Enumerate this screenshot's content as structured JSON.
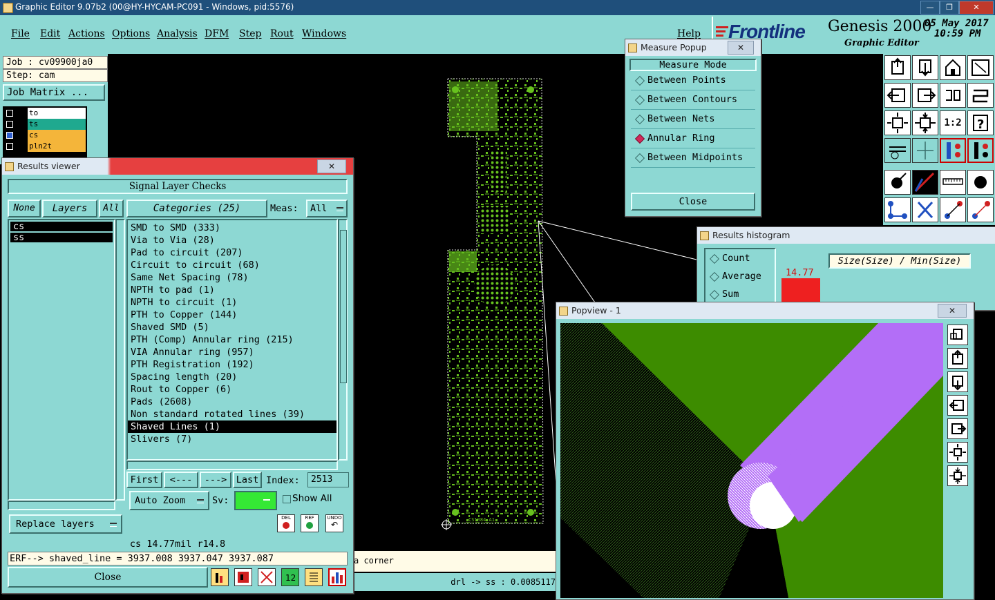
{
  "window": {
    "title": "Graphic Editor 9.07b2 (00@HY-HYCAM-PC091 - Windows, pid:5576)",
    "controls": [
      "minimize",
      "maximize",
      "close"
    ]
  },
  "menu": {
    "items": [
      "File",
      "Edit",
      "Actions",
      "Options",
      "Analysis",
      "DFM",
      "Step",
      "Rout",
      "Windows"
    ],
    "help": "Help"
  },
  "brand": {
    "logo": "Frontline",
    "product": "Genesis 2000",
    "subtitle": "Graphic Editor",
    "date": "05 May 2017",
    "time": "10:59 PM"
  },
  "job": {
    "job_label": "Job : cv09900ja0",
    "step_label": "Step: cam",
    "matrix_button": "Job Matrix ..."
  },
  "layers": [
    {
      "name": "to",
      "color": "#ffffff"
    },
    {
      "name": "ts",
      "color": "#1fa98f"
    },
    {
      "name": "cs",
      "color": "#f4b53a"
    },
    {
      "name": "pln2t",
      "color": "#f4b53a"
    }
  ],
  "results_viewer": {
    "title": "Results viewer",
    "header": "Signal Layer Checks",
    "none_btn": "None",
    "layers_btn": "Layers",
    "all_btn": "All",
    "layer_list": [
      "cs",
      "ss"
    ],
    "categories_btn": "Categories (25)",
    "meas_label": "Meas:",
    "meas_value": "All",
    "categories": [
      "SMD to SMD (333)",
      "Via to Via (28)",
      "Pad to circuit (207)",
      "Circuit to circuit (68)",
      "Same Net Spacing (78)",
      "NPTH to pad (1)",
      "NPTH to circuit (1)",
      "PTH to Copper (144)",
      "Shaved SMD (5)",
      "PTH (Comp) Annular ring (215)",
      "VIA Annular ring (957)",
      "PTH Registration (192)",
      "Spacing length (20)",
      "Rout to Copper (6)",
      "Pads (2608)",
      "Non standard rotated lines (39)",
      "Shaved Lines (1)",
      "Slivers (7)"
    ],
    "selected_index": 16,
    "nav": {
      "first": "First",
      "prev": "<---",
      "next": "--->",
      "last": "Last",
      "index_label": "Index:",
      "index_value": "2513"
    },
    "auto_zoom": "Auto Zoom",
    "sv_label": "Sv:",
    "show_all": "Show All",
    "replace_layers": "Replace layers",
    "small_buttons": [
      "DEL",
      "REF",
      "UNDO"
    ],
    "status1": "cs  14.77mil  r14.8",
    "status2": "ERF--> shaved_line = 3937.008 3937.047 3937.087",
    "close": "Close"
  },
  "measure_popup": {
    "title": "Measure Popup",
    "mode_header": "Measure Mode",
    "options": [
      "Between Points",
      "Between Contours",
      "Between Nets",
      "Annular Ring",
      "Between Midpoints"
    ],
    "selected": "Annular Ring",
    "close": "Close"
  },
  "histogram": {
    "title": "Results histogram",
    "options": [
      "Count",
      "Average",
      "Sum"
    ],
    "label": "Size(Size) / Min(Size)",
    "value": "14.77",
    "bar_color": "#ee2020"
  },
  "popview": {
    "title": "Popview - 1",
    "colors": {
      "green": "#3d8c00",
      "purple": "#b36ef7"
    }
  },
  "canvas": {
    "board_label": "CS1084 A1",
    "status_left": "a corner",
    "status_right": "drl -> ss : 0.0085117"
  },
  "colors": {
    "panel": "#8dd8d3",
    "board": "#67c11e",
    "titlebar": "#1f4f7b"
  }
}
